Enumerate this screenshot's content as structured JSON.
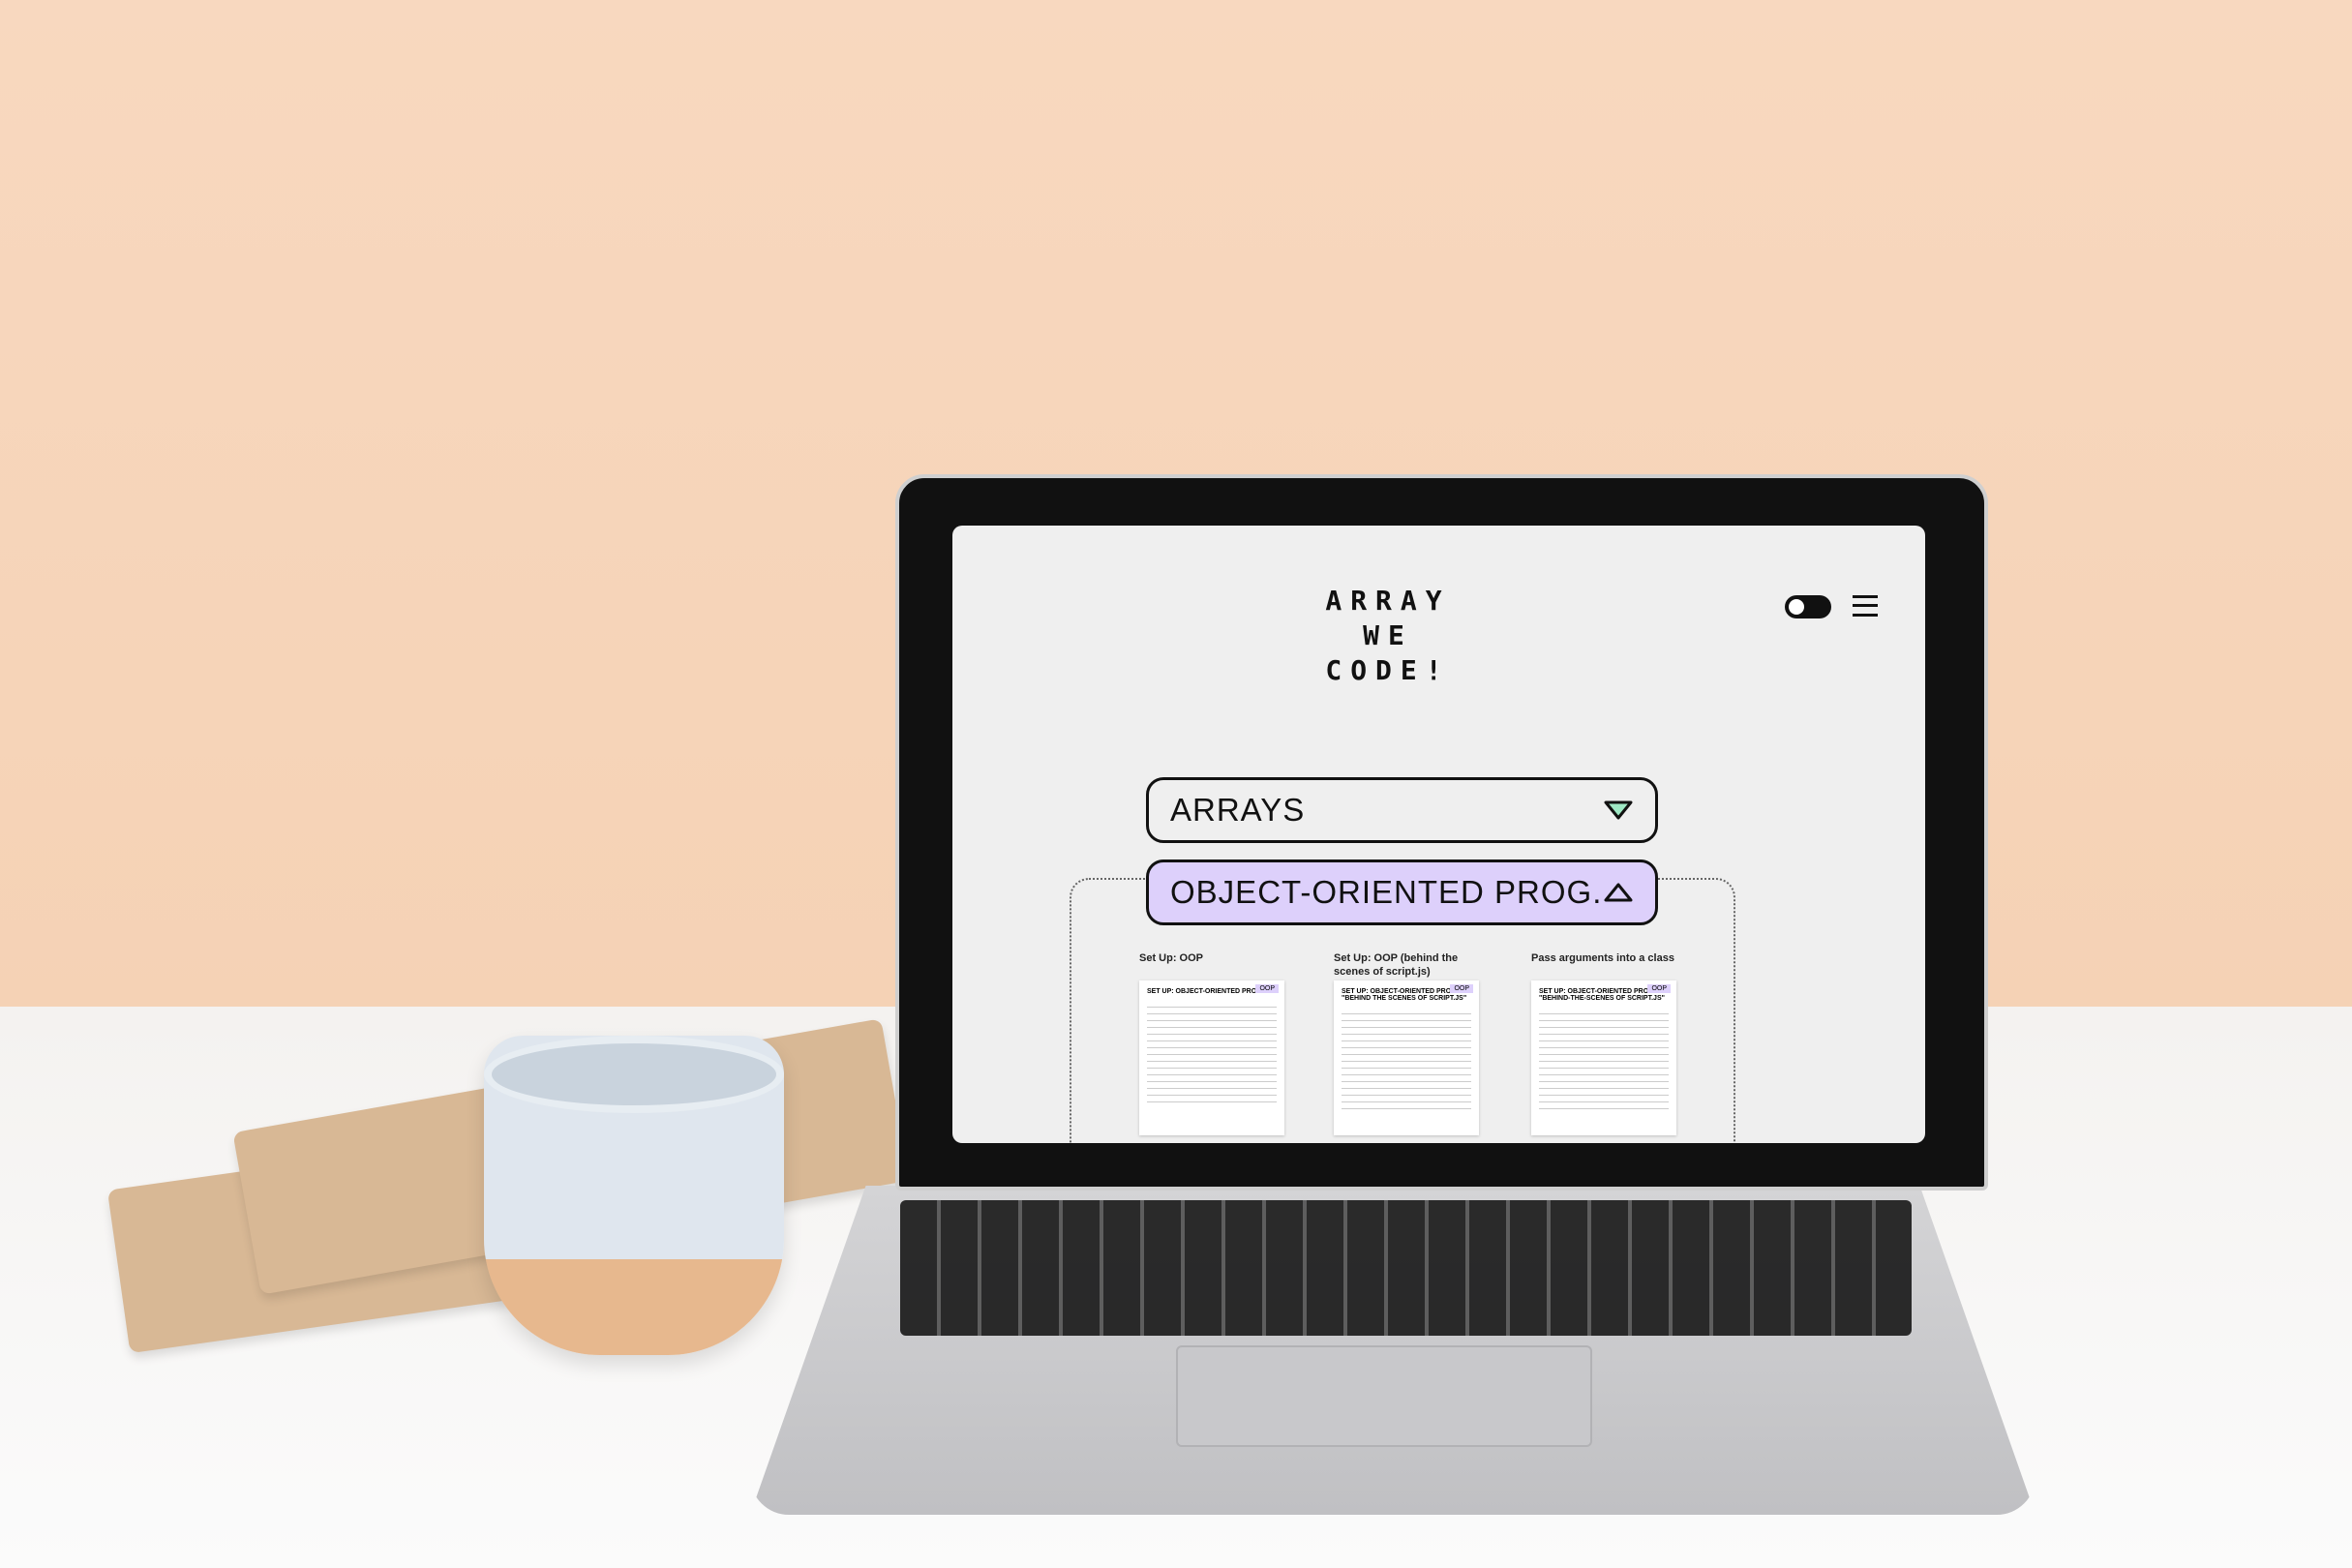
{
  "app": {
    "logo": "ARRAY WE CODE!",
    "logo_lines": [
      "ARRAY",
      "WE",
      "CODE!"
    ]
  },
  "header": {
    "theme_toggle_icon": "dark-mode-toggle-icon",
    "menu_icon": "hamburger-menu-icon"
  },
  "dropdowns": [
    {
      "label": "ARRAYS",
      "state": "collapsed",
      "icon": "chevron-down-triangle-icon",
      "color": "#efefef",
      "icon_color": "#9ee8c4"
    },
    {
      "label": "OBJECT-ORIENTED PROG.",
      "state": "expanded",
      "icon": "chevron-up-triangle-icon",
      "color": "#ddd0fb"
    }
  ],
  "cards": [
    {
      "title": "Set Up: OOP",
      "thumb_title": "SET UP: OBJECT-ORIENTED PROG.",
      "badge": "OOP"
    },
    {
      "title": "Set Up: OOP (behind the scenes of script.js)",
      "thumb_title": "SET UP: OBJECT-ORIENTED PROG. \"BEHIND THE SCENES OF SCRIPT.JS\"",
      "badge": "OOP"
    },
    {
      "title": "Pass arguments into a class",
      "thumb_title": "SET UP: OBJECT-ORIENTED PROG. \"BEHIND-THE-SCENES OF SCRIPT.JS\"",
      "badge": "OOP"
    }
  ]
}
